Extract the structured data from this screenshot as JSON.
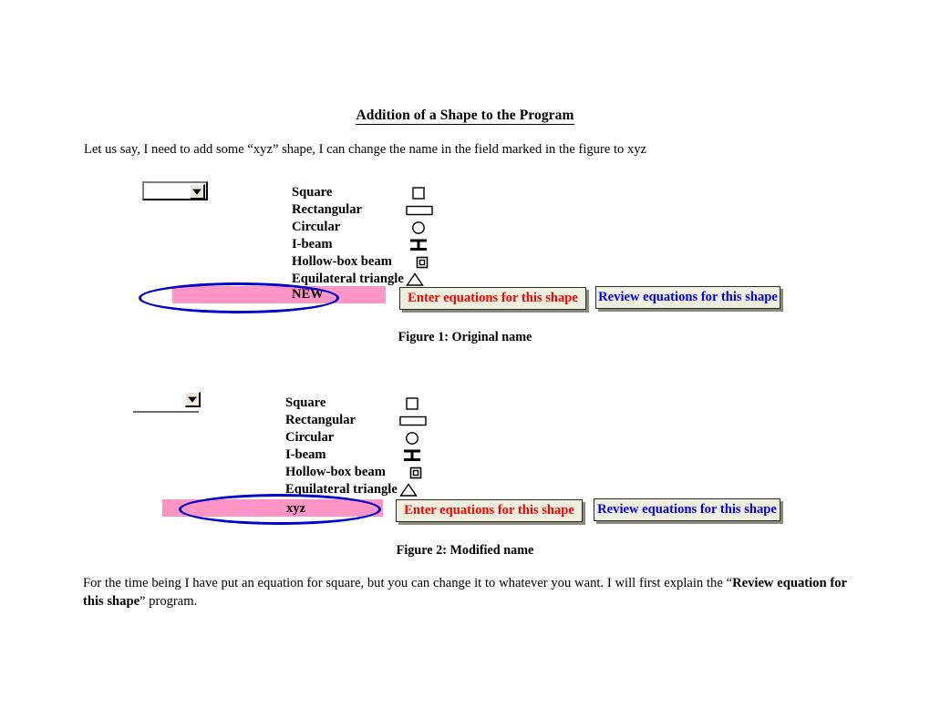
{
  "document": {
    "title": "Addition of a Shape to the Program",
    "intro_paragraph": "Let us say, I need to add some “xyz” shape, I can change the name in the field marked in the figure to xyz",
    "outro_paragraph_part1": "For the time being I have put an equation for square, but you can change it to whatever you want. I will first explain the “",
    "outro_paragraph_bold": "Review equation for this shape",
    "outro_paragraph_part2": "” program."
  },
  "figure1": {
    "caption": "Figure 1: Original name",
    "dropdown": {
      "value": "",
      "arrow_icon": "chevron-down-icon"
    },
    "shapes": [
      {
        "label": "Square",
        "icon": "square-icon"
      },
      {
        "label": "Rectangular",
        "icon": "rectangle-icon"
      },
      {
        "label": "Circular",
        "icon": "circle-icon"
      },
      {
        "label": "I-beam",
        "icon": "i-beam-icon"
      },
      {
        "label": "Hollow-box beam",
        "icon": "hollow-box-icon"
      },
      {
        "label": "Equilateral triangle",
        "icon": "triangle-icon"
      }
    ],
    "highlighted_shape": "NEW",
    "annotation": "blue-ellipse-highlight",
    "buttons": {
      "enter": "Enter equations for this shape",
      "review": "Review equations for this shape"
    }
  },
  "figure2": {
    "caption": "Figure 2: Modified name",
    "dropdown": {
      "value": "",
      "arrow_icon": "chevron-down-icon"
    },
    "shapes": [
      {
        "label": "Square",
        "icon": "square-icon"
      },
      {
        "label": "Rectangular",
        "icon": "rectangle-icon"
      },
      {
        "label": "Circular",
        "icon": "circle-icon"
      },
      {
        "label": "I-beam",
        "icon": "i-beam-icon"
      },
      {
        "label": "Hollow-box beam",
        "icon": "hollow-box-icon"
      },
      {
        "label": "Equilateral triangle",
        "icon": "triangle-icon"
      }
    ],
    "highlighted_shape": "xyz",
    "annotation": "blue-ellipse-highlight",
    "buttons": {
      "enter": "Enter equations for this shape",
      "review": "Review equations for this shape"
    }
  },
  "colors": {
    "highlight_pink": "#ff95c4",
    "annotation_blue": "#0000c8",
    "enter_button_text": "#ff0000",
    "review_button_text": "#0000ee",
    "button_face": "#efefe0"
  }
}
